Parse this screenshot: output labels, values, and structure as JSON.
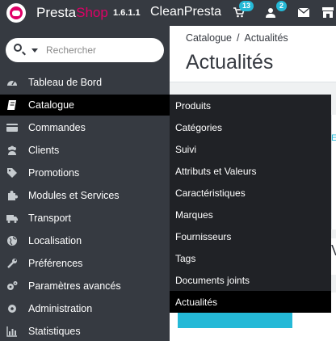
{
  "header": {
    "brand_main": "Presta",
    "brand_accent": "Shop",
    "version": "1.6.1.1",
    "shop_name": "CleanPresta",
    "orders_badge": "13",
    "customers_badge": "2",
    "icons": [
      "cart-icon",
      "user-icon",
      "envelope-icon",
      "store-icon"
    ]
  },
  "search": {
    "placeholder": "Rechercher"
  },
  "sidebar": {
    "items": [
      {
        "label": "Tableau de Bord",
        "icon": "dashboard-icon"
      },
      {
        "label": "Catalogue",
        "icon": "book-icon"
      },
      {
        "label": "Commandes",
        "icon": "credit-card-icon"
      },
      {
        "label": "Clients",
        "icon": "users-icon"
      },
      {
        "label": "Promotions",
        "icon": "tag-icon"
      },
      {
        "label": "Modules et Services",
        "icon": "puzzle-icon"
      },
      {
        "label": "Transport",
        "icon": "truck-icon"
      },
      {
        "label": "Localisation",
        "icon": "globe-icon"
      },
      {
        "label": "Préférences",
        "icon": "wrench-icon"
      },
      {
        "label": "Paramètres avancés",
        "icon": "cogs-icon"
      },
      {
        "label": "Administration",
        "icon": "gear-icon"
      },
      {
        "label": "Statistiques",
        "icon": "bar-chart-icon"
      }
    ]
  },
  "breadcrumb": {
    "parent": "Catalogue",
    "separator": "/",
    "current": "Actualités"
  },
  "page": {
    "title": "Actualités",
    "peek_char_1": "E",
    "peek_char_2": "V"
  },
  "submenu": {
    "items": [
      "Produits",
      "Catégories",
      "Suivi",
      "Attributs et Valeurs",
      "Caractéristiques",
      "Marques",
      "Fournisseurs",
      "Tags",
      "Documents joints",
      "Actualités"
    ]
  },
  "colors": {
    "brand": "#df0067",
    "accent": "#25b9d7",
    "sidebar": "#363a41",
    "submenu": "#202226"
  }
}
